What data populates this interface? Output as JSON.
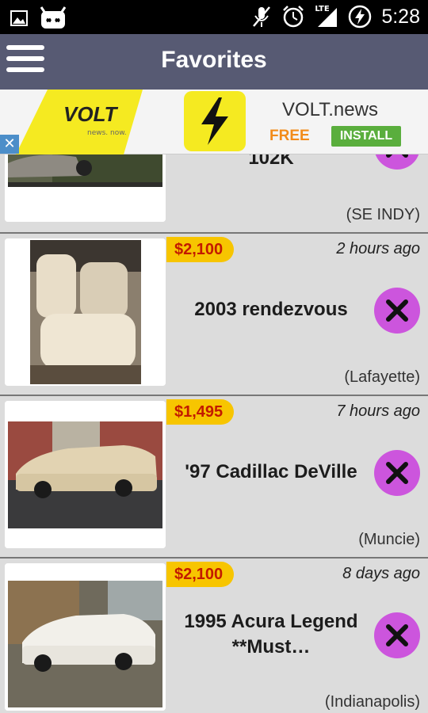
{
  "status_bar": {
    "time": "5:28",
    "network": "LTE",
    "left_icons": [
      "image-icon",
      "android-icon"
    ],
    "right_icons": [
      "mute-icon",
      "alarm-icon",
      "signal-icon",
      "battery-charging-icon"
    ]
  },
  "app_bar": {
    "title": "Favorites",
    "menu_icon": "hamburger-menu-icon"
  },
  "ad": {
    "logo_text": "VOLT",
    "logo_tagline": "news. now.",
    "brand": "VOLT.news",
    "price_label": "FREE",
    "install_label": "INSTALL",
    "close_glyph": "✕",
    "colors": {
      "yellow": "#f5ea21",
      "install": "#5aae3d",
      "free": "#f28b1a"
    }
  },
  "listings": [
    {
      "price": "",
      "time": "",
      "title": "102K",
      "location": "(SE INDY)",
      "partial": true
    },
    {
      "price": "$2,100",
      "time": "2 hours ago",
      "title": "2003 rendezvous",
      "location": "(Lafayette)"
    },
    {
      "price": "$1,495",
      "time": "7 hours ago",
      "title": "'97 Cadillac DeVille",
      "location": "(Muncie)"
    },
    {
      "price": "$2,100",
      "time": "8 days ago",
      "title": "1995 Acura Legend **Must…",
      "location": "(Indianapolis)"
    }
  ],
  "colors": {
    "app_bar": "#575a73",
    "price_bg": "#f7c500",
    "price_text": "#c31a00",
    "remove_btn": "#cc55dd"
  }
}
